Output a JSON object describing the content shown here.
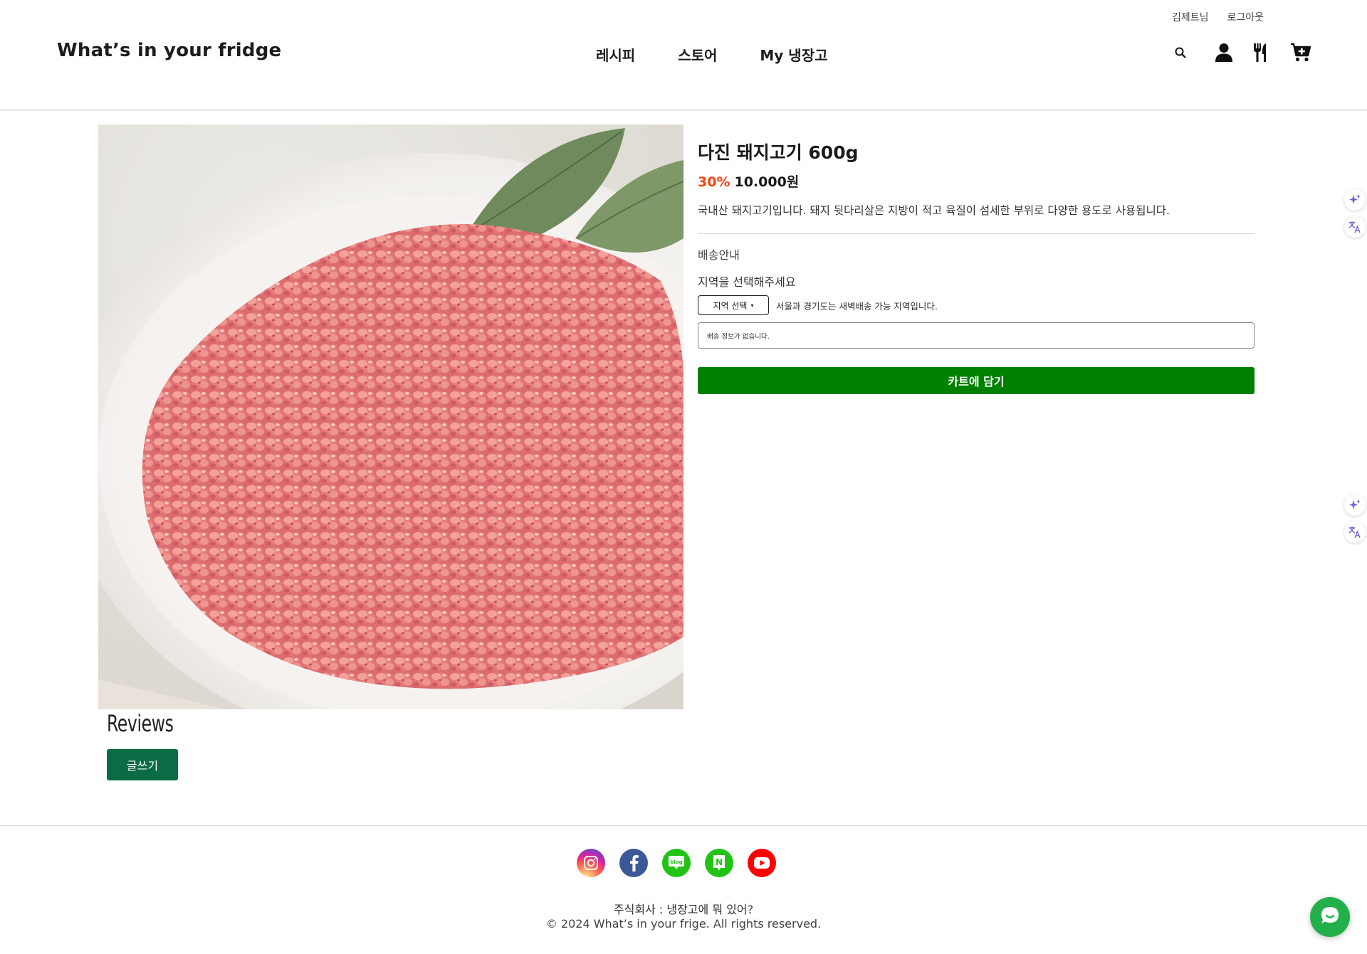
{
  "header": {
    "user_name": "김제트님",
    "logout_label": "로그아웃",
    "logo": "What’s in your fridge",
    "nav": [
      {
        "label": "레시피"
      },
      {
        "label": "스토어"
      },
      {
        "label": "My 냉장고"
      }
    ],
    "icons": [
      "search-icon",
      "user-icon",
      "utensils-icon",
      "cart-plus-icon"
    ]
  },
  "product": {
    "title": "다진 돼지고기 600g",
    "discount": "30%",
    "price": "10.000원",
    "description": "국내산 돼지고기입니다. 돼지 뒷다리살은 지방이 적고 육질이 섬세한 부위로 다양한 용도로 사용됩니다.",
    "shipping_title": "배송안내",
    "region_label": "지역을 선택해주세요",
    "region_select": "지역 선택",
    "region_note": "서울과 경기도는 새벽배송 가능 지역입니다.",
    "shipping_info": "배송 정보가 없습니다.",
    "cart_button": "카트에 담기"
  },
  "reviews": {
    "title": "Reviews",
    "write_button": "글쓰기"
  },
  "footer": {
    "social": [
      {
        "name": "instagram-icon",
        "color": "#d6249f"
      },
      {
        "name": "facebook-icon",
        "color": "#3b5998"
      },
      {
        "name": "blog-icon",
        "color": "#21c414",
        "text": "blog"
      },
      {
        "name": "naver-icon",
        "color": "#21c414",
        "text": "N"
      },
      {
        "name": "youtube-icon",
        "color": "#ff0000"
      }
    ],
    "company": "주식회사 : 냉장고에 뭐 있어?",
    "copyright": "© 2024 What’s in your frige. All rights reserved."
  },
  "colors": {
    "accent_green": "#008000",
    "write_green": "#0b6b45",
    "discount_orange": "#f5450f",
    "side_purple": "#7b5cd6"
  }
}
